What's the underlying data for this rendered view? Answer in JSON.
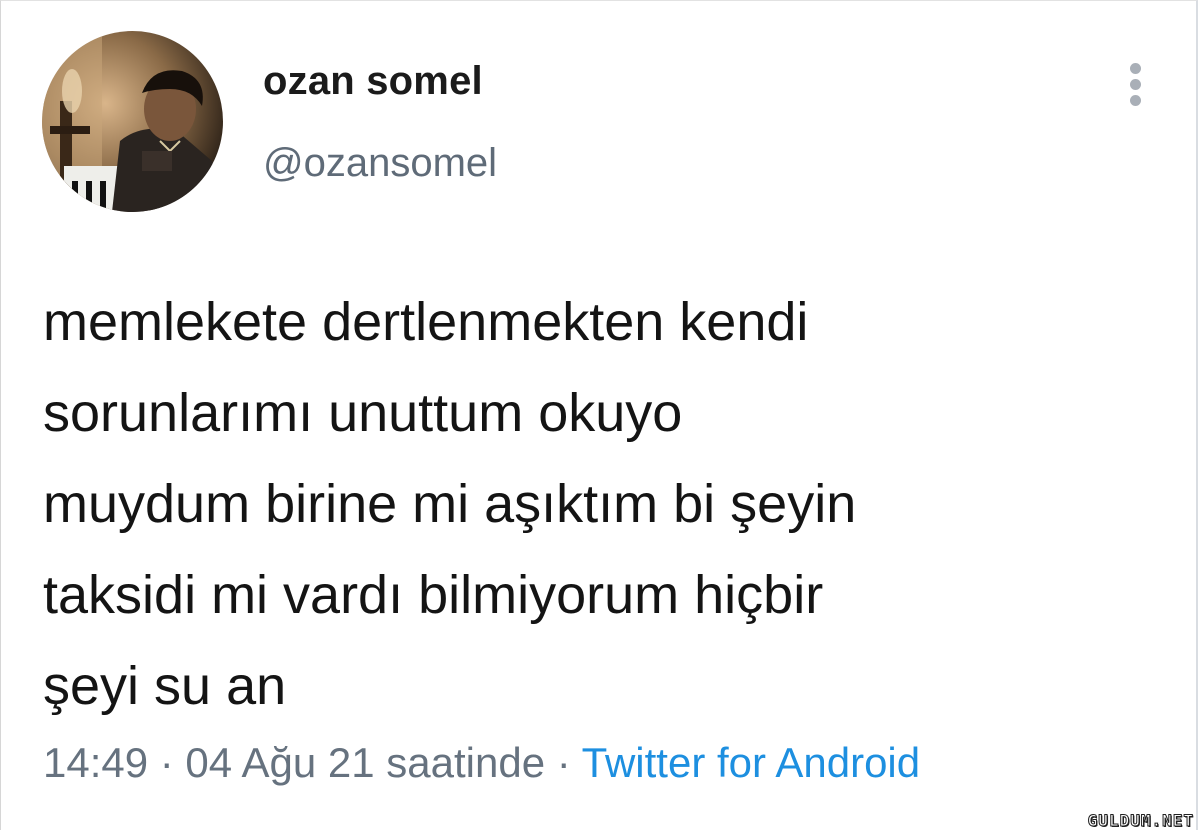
{
  "user": {
    "display_name": "ozan somel",
    "handle": "@ozansomel"
  },
  "menu": {
    "icon": "more-vertical-icon"
  },
  "tweet": {
    "lines": [
      "memlekete dertlenmekten kendi",
      "sorunlarımı unuttum okuyo",
      "muydum birine mi aşıktım bi şeyin",
      "taksidi mi vardı bilmiyorum hiçbir",
      "şeyi su an"
    ],
    "timestamp": "14:49 · 04 Ağu 21 saatinde · ",
    "source": "Twitter for Android"
  },
  "watermark": "GULDUM.NET",
  "colors": {
    "name": "#1b1b1b",
    "handle": "#5f6b78",
    "text": "#141414",
    "meta": "#66727f",
    "link": "#1d8fe0"
  }
}
